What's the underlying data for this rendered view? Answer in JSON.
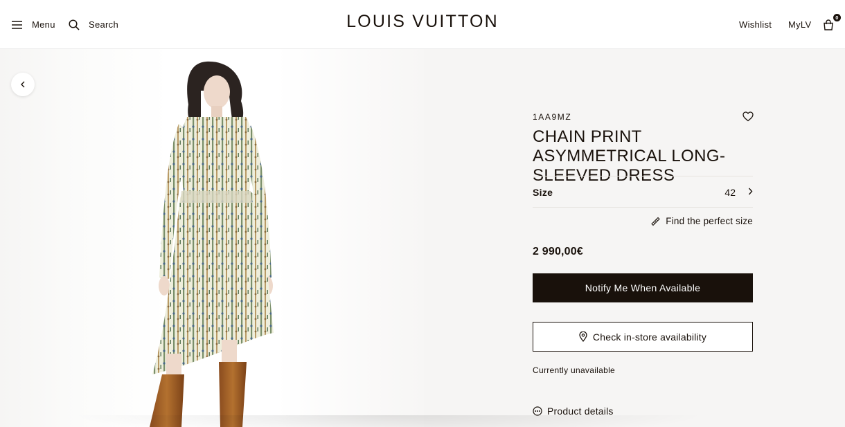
{
  "header": {
    "menu_label": "Menu",
    "search_label": "Search",
    "brand": "LOUIS VUITTON",
    "wishlist_label": "Wishlist",
    "mylv_label": "MyLV",
    "bag_count": "0"
  },
  "product": {
    "sku": "1AA9MZ",
    "title": "CHAIN PRINT ASYMMETRICAL LONG-SLEEVED DRESS",
    "size_label": "Size",
    "size_value": "42",
    "find_size_label": "Find the perfect size",
    "price": "2 990,00€",
    "notify_button": "Notify Me When Available",
    "store_button": "Check in-store availability",
    "availability_status": "Currently unavailable",
    "details_label": "Product details"
  },
  "icons": {
    "menu": "hamburger-icon",
    "search": "search-icon",
    "bag": "shopping-bag-icon",
    "prev": "chevron-left-icon",
    "wishlist": "heart-icon",
    "size": "chevron-right-icon",
    "find_size": "ruler-icon",
    "store": "location-pin-icon",
    "details": "more-dots-icon"
  },
  "colors": {
    "brand_dark": "#19110b",
    "panel_bg": "#f6f5f4",
    "boot_brown": "#a8642e"
  }
}
